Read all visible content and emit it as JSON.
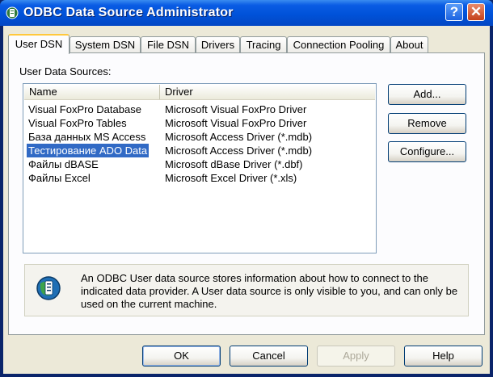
{
  "window": {
    "title": "ODBC Data Source Administrator",
    "help_glyph": "?",
    "close_glyph": "✕"
  },
  "tabs": [
    {
      "label": "User DSN",
      "active": true
    },
    {
      "label": "System DSN"
    },
    {
      "label": "File DSN"
    },
    {
      "label": "Drivers"
    },
    {
      "label": "Tracing"
    },
    {
      "label": "Connection Pooling"
    },
    {
      "label": "About"
    }
  ],
  "user_dsn": {
    "sources_label": "User Data Sources:",
    "columns": {
      "name": "Name",
      "driver": "Driver"
    },
    "rows": [
      {
        "name": "Visual FoxPro Database",
        "driver": "Microsoft Visual FoxPro Driver"
      },
      {
        "name": "Visual FoxPro Tables",
        "driver": "Microsoft Visual FoxPro Driver"
      },
      {
        "name": "База данных MS Access",
        "driver": "Microsoft Access Driver (*.mdb)"
      },
      {
        "name": "Тестирование ADO Data",
        "driver": "Microsoft Access Driver (*.mdb)",
        "selected": true
      },
      {
        "name": "Файлы dBASE",
        "driver": "Microsoft dBase Driver (*.dbf)"
      },
      {
        "name": "Файлы Excel",
        "driver": "Microsoft Excel Driver (*.xls)"
      }
    ],
    "buttons": {
      "add": "Add...",
      "remove": "Remove",
      "configure": "Configure..."
    },
    "info_text": "An ODBC User data source stores information about how to connect to the indicated data provider.  A User data source is only visible to you, and can only be used on the current machine."
  },
  "footer_buttons": {
    "ok": "OK",
    "cancel": "Cancel",
    "apply": "Apply",
    "help": "Help"
  },
  "colors": {
    "titlebar": "#0052d9",
    "selection": "#316ac5",
    "active_tab_accent": "#ffc83c"
  }
}
